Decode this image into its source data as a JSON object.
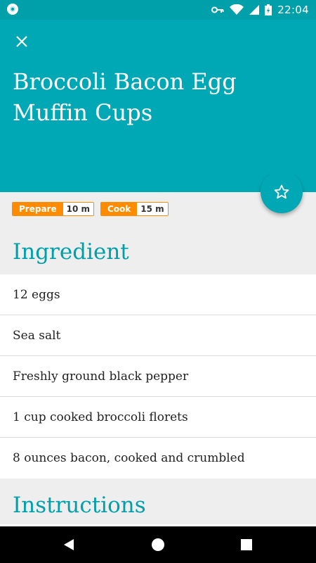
{
  "status_bar": {
    "time": "22:04"
  },
  "header": {
    "title": "Broccoli Bacon Egg Muffin Cups",
    "close_icon": "close-icon",
    "background_color": "#00a8b5"
  },
  "favorite": {
    "icon": "star-outline-icon"
  },
  "times": [
    {
      "label": "Prepare",
      "value": "10 m"
    },
    {
      "label": "Cook",
      "value": "15 m"
    }
  ],
  "ingredients": {
    "heading": "Ingredient",
    "items": [
      "12 eggs",
      "Sea salt",
      "Freshly ground black pepper",
      "1 cup cooked broccoli florets",
      "8 ounces bacon, cooked and crumbled"
    ]
  },
  "instructions": {
    "heading": "Instructions"
  },
  "colors": {
    "accent": "#00a0aa",
    "badge": "#ff8c00"
  },
  "nav": {
    "back_icon": "back-triangle-icon",
    "home_icon": "home-circle-icon",
    "recents_icon": "recents-square-icon"
  }
}
